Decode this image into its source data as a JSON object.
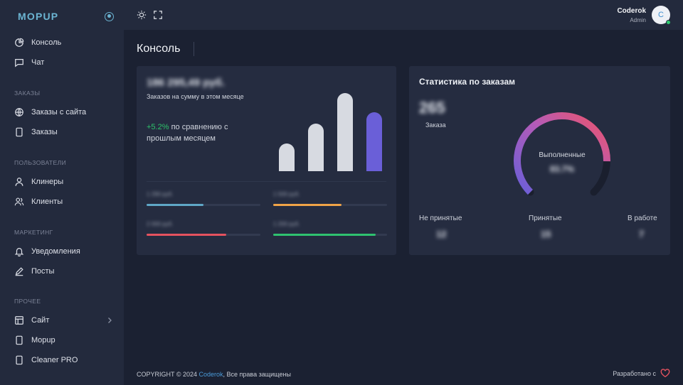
{
  "sidebar": {
    "logo": "MOPUP",
    "items": [
      {
        "label": "Консоль",
        "icon": "pie-chart-icon"
      },
      {
        "label": "Чат",
        "icon": "message-icon"
      },
      {
        "label": "Заказы с сайта",
        "icon": "globe-icon"
      },
      {
        "label": "Заказы",
        "icon": "tablet-icon"
      },
      {
        "label": "Клинеры",
        "icon": "user-icon"
      },
      {
        "label": "Клиенты",
        "icon": "users-icon"
      },
      {
        "label": "Уведомления",
        "icon": "bell-icon"
      },
      {
        "label": "Посты",
        "icon": "pen-icon"
      },
      {
        "label": "Сайт",
        "icon": "layout-icon"
      },
      {
        "label": "Mopup",
        "icon": "tablet-icon"
      },
      {
        "label": "Cleaner PRO",
        "icon": "tablet-icon"
      }
    ],
    "sections": [
      "Заказы",
      "Пользователи",
      "Маркетинг",
      "Прочее"
    ]
  },
  "topbar": {
    "user_name": "Coderok",
    "user_role": "Admin",
    "avatar_letter": "C"
  },
  "page": {
    "title": "Консоль"
  },
  "revenue_card": {
    "amount": "186 295,49 руб.",
    "description": "Заказов на сумму в этом месяце",
    "change_pct": "+5.2%",
    "change_text": "по сравнению с прошлым месяцем",
    "bars": [
      {
        "value": 0.35,
        "color": "#d7dae1"
      },
      {
        "value": 0.6,
        "color": "#d7dae1"
      },
      {
        "value": 0.98,
        "color": "#d7dae1"
      },
      {
        "value": 0.74,
        "color": "#6a5fd8"
      }
    ],
    "progress": [
      {
        "label": "1 290 руб.",
        "fill": 0.5,
        "color": "#5fa7c7"
      },
      {
        "label": "1 500 руб.",
        "fill": 0.6,
        "color": "#f0a347"
      },
      {
        "label": "2 000 руб.",
        "fill": 0.7,
        "color": "#e5525f"
      },
      {
        "label": "1 200 руб.",
        "fill": 0.9,
        "color": "#2fc270"
      }
    ]
  },
  "orders_card": {
    "title": "Статистика по заказам",
    "total": "265",
    "total_label": "Заказа",
    "gauge_label": "Выполненные",
    "gauge_value": "83.7%",
    "gauge_fraction": 0.837,
    "stats": [
      {
        "label": "Не принятые",
        "value": "12"
      },
      {
        "label": "Принятые",
        "value": "15"
      },
      {
        "label": "В работе",
        "value": "7"
      }
    ]
  },
  "footer": {
    "copyright": "COPYRIGHT © 2024 ",
    "link": "Coderok",
    "rights": ", Все права защищены",
    "dev": "Разработано с"
  }
}
